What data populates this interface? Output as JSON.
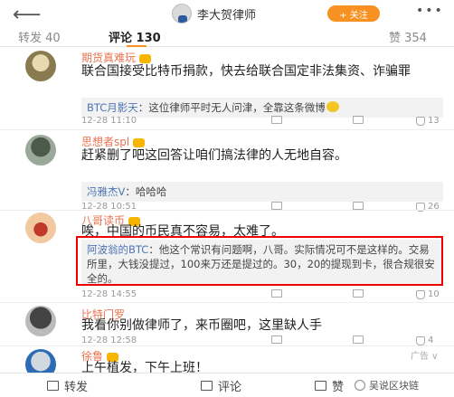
{
  "topbar": {
    "back_icon": "arrow-left-icon",
    "author_name": "李大贺律师",
    "follow_label": "+ 关注",
    "more_label": "•••"
  },
  "tabs": {
    "repost": "转发 40",
    "comment": "评论 130",
    "like": "赞 354"
  },
  "comments": [
    {
      "name": "期货真难玩",
      "text": "联合国接受比特币捐款，快去给联合国定非法集资、诈骗罪",
      "reply_name": "BTC月影天",
      "reply_text": "：这位律师平时无人问津，全靠这条微博",
      "time": "12-28 11:10",
      "reposts": "",
      "replies": "",
      "likes": "13"
    },
    {
      "name": "思想者spl",
      "text": "赶紧删了吧这回答让咱们搞法律的人无地自容。",
      "reply_name": "冯雅杰V",
      "reply_text": "：哈哈哈",
      "time": "12-28 10:51",
      "reposts": "",
      "replies": "",
      "likes": "26"
    },
    {
      "name": "八哥读币",
      "text": "唉，中国的币民真不容易，太难了。",
      "reply_name": "阿波翁的BTC",
      "reply_text": "：他这个常识有问题啊，八哥。实际情况可不是这样的。交易所里，大钱没提过，100来万还是提过的。30，20的提现到卡，很合规很安全的。",
      "time": "12-28 14:55",
      "reposts": "",
      "replies": "",
      "likes": "10"
    },
    {
      "name": "比特门罗",
      "text": "我看你别做律师了，来币圈吧，这里缺人手",
      "time": "12-28 12:58",
      "reposts": "",
      "replies": "",
      "likes": "4"
    },
    {
      "name": "徐鲁",
      "text": "上午植发，下午上班！",
      "ad_label": "广告 ∨"
    }
  ],
  "bottombar": {
    "repost": "转发",
    "comment": "评论",
    "like": "赞"
  },
  "watermark": "吴说区块链"
}
